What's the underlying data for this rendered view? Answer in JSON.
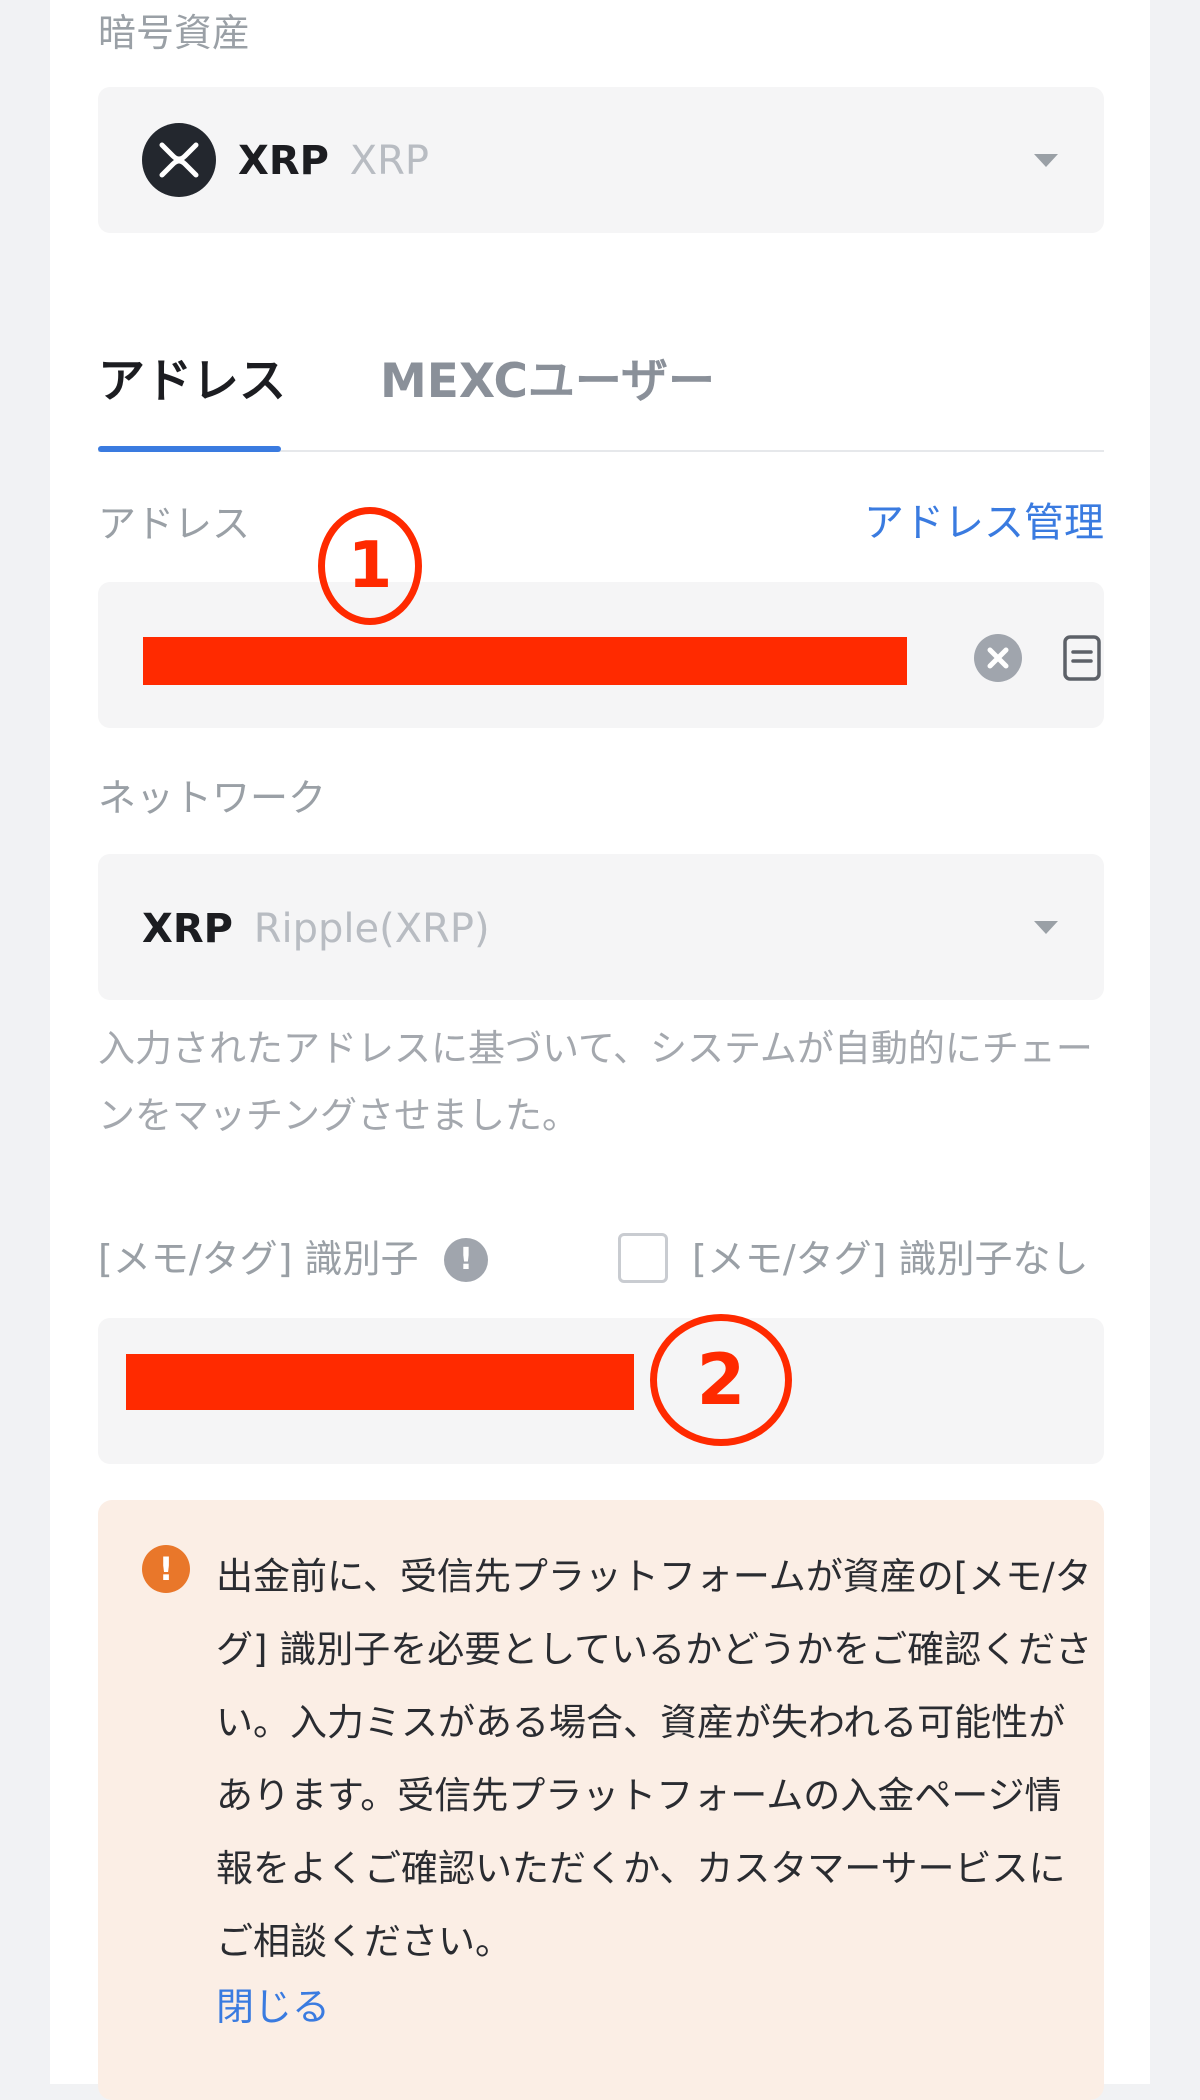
{
  "asset": {
    "label": "暗号資産",
    "coin_symbol": "XRP",
    "coin_name": "XRP",
    "icon": "xrp-logo-icon"
  },
  "tabs": [
    {
      "label": "アドレス",
      "active": true
    },
    {
      "label": "MEXCユーザー",
      "active": false
    }
  ],
  "address": {
    "label": "アドレス",
    "manage_link": "アドレス管理",
    "value": "",
    "clear_icon": "close-circle-icon",
    "paste_icon": "document-icon"
  },
  "network": {
    "label": "ネットワーク",
    "symbol": "XRP",
    "name": "Ripple(XRP)",
    "hint": "入力されたアドレスに基づいて、システムが自動的にチェーンをマッチングさせました。"
  },
  "memo": {
    "label": "[メモ/タグ] 識別子",
    "info_icon": "exclamation-circle-icon",
    "no_memo_label": "[メモ/タグ] 識別子なし",
    "no_memo_checked": false,
    "value": ""
  },
  "warning": {
    "icon": "warning-icon",
    "text": "出金前に、受信先プラットフォームが資産の[メモ/タグ] 識別子を必要としているかどうかをご確認ください。入力ミスがある場合、資産が失われる可能性があります。受信先プラットフォームの入金ページ情報をよくご確認いただくか、カスタマーサービスにご相談ください。",
    "close_label": "閉じる"
  },
  "annotations": [
    "1",
    "2"
  ],
  "colors": {
    "accent": "#3a7be0",
    "redaction": "#ff2a00",
    "warning_icon": "#e9772a",
    "warning_bg": "#fbeee5"
  }
}
